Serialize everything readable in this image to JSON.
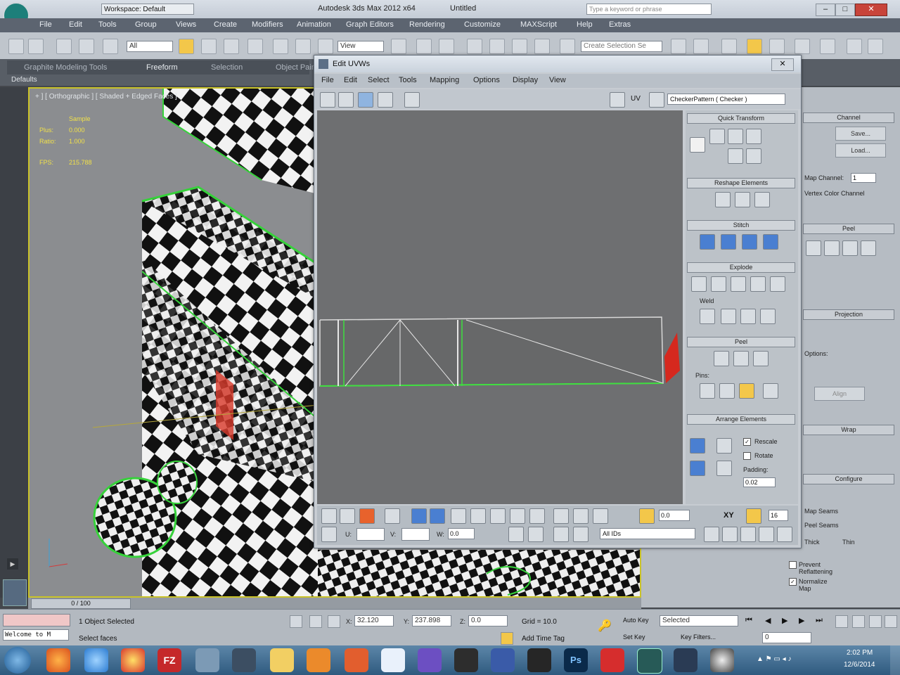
{
  "app": {
    "title": "Autodesk 3ds Max 2012 x64",
    "document": "Untitled",
    "workspace": "Workspace: Default",
    "search_placeholder": "Type a keyword or phrase"
  },
  "menu": [
    "File",
    "Edit",
    "Tools",
    "Group",
    "Views",
    "Create",
    "Modifiers",
    "Animation",
    "Graph Editors",
    "Rendering",
    "Customize",
    "MAXScript",
    "Help",
    "Extras"
  ],
  "toolbar": {
    "selection_filter": "All",
    "ref_coord": "View",
    "named_selection_placeholder": "Create Selection Se"
  },
  "ribbon": {
    "tabs": [
      "Graphite Modeling Tools",
      "Freeform",
      "Selection",
      "Object Paint"
    ],
    "label": "Defaults"
  },
  "viewport": {
    "label": "+ ] [ Orthographic ] [ Shaded + Edged Faces ]",
    "stats": {
      "heading": "Sample",
      "fps_label": "FPS:",
      "fps_value": "215.788",
      "line1_label": "Plus:",
      "line1_value": "0.000",
      "line2_label": "Ratio:",
      "line2_value": "1.000"
    }
  },
  "uvw_editor": {
    "title": "Edit UVWs",
    "menu": [
      "File",
      "Edit",
      "Select",
      "Tools",
      "Mapping",
      "Options",
      "Display",
      "View"
    ],
    "uv_label": "UV",
    "map_dropdown": "CheckerPattern ( Checker )",
    "rollouts": {
      "quick_transform": "Quick Transform",
      "reshape": "Reshape Elements",
      "stitch": "Stitch",
      "explode": "Explode",
      "weld": "Weld",
      "peel": "Peel",
      "pins": "Pins:",
      "arrange": "Arrange Elements",
      "rescale": "Rescale",
      "rotate": "Rotate",
      "padding_label": "Padding:",
      "padding_value": "0.02"
    },
    "bottom": {
      "u_label": "U:",
      "v_label": "V:",
      "w_label": "W:",
      "w_value": "0.0",
      "value1": "0.0",
      "xy": "XY",
      "value2": "16",
      "all_ids": "All IDs"
    }
  },
  "command_panel": {
    "channel": "Channel",
    "save": "Save...",
    "load": "Load...",
    "map_channel": "Map Channel:",
    "map_channel_value": "1",
    "vertex_color": "Vertex Color Channel",
    "peel": "Peel",
    "projection": "Projection",
    "options": "Options:",
    "align": "Align",
    "wrap": "Wrap",
    "configure": "Configure",
    "map_seams": "Map Seams",
    "peel_seams": "Peel Seams",
    "thick": "Thick",
    "thin": "Thin",
    "prevent_reflattening": "Prevent Reflattening",
    "normalize_map": "Normalize Map"
  },
  "timeline": {
    "frame": "0 / 100"
  },
  "status": {
    "selection": "1 Object Selected",
    "prompt": "Select faces",
    "listener": "Welcome to M",
    "x_label": "X:",
    "x_value": "32.120",
    "y_label": "Y:",
    "y_value": "237.898",
    "z_label": "Z:",
    "z_value": "0.0",
    "grid": "Grid = 10.0",
    "add_time_tag": "Add Time Tag",
    "auto_key": "Auto Key",
    "set_key": "Set Key",
    "selected": "Selected",
    "key_filters": "Key Filters...",
    "frame_field": "0"
  },
  "taskbar": {
    "time": "2:02 PM",
    "date": "12/6/2014"
  }
}
